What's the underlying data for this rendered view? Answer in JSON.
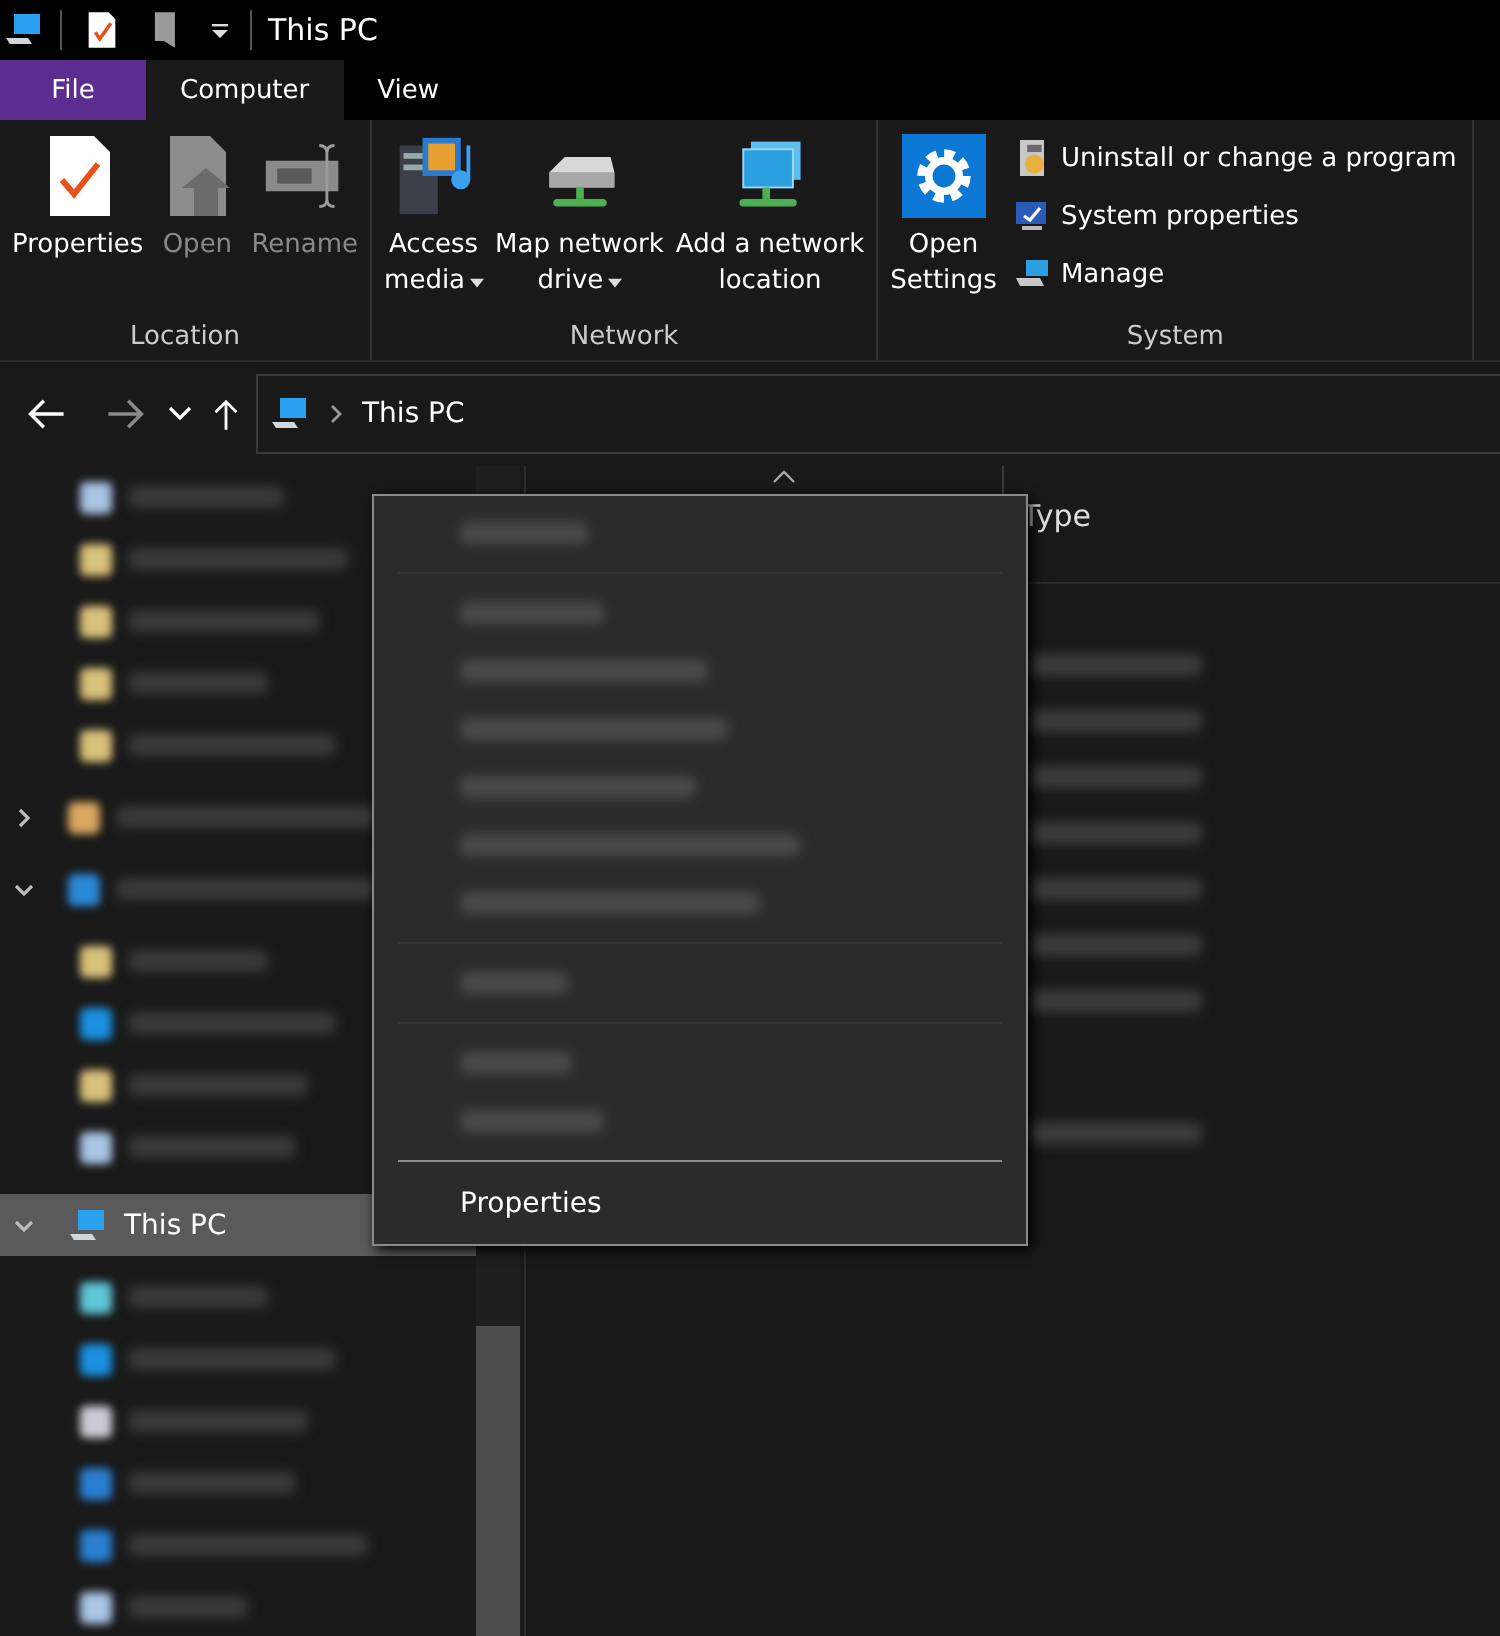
{
  "title_bar": {
    "title": "This PC"
  },
  "tabs": [
    {
      "label": "File",
      "kind": "file",
      "selected": false
    },
    {
      "label": "Computer",
      "kind": "tab",
      "selected": true
    },
    {
      "label": "View",
      "kind": "tab",
      "selected": false
    }
  ],
  "ribbon": {
    "groups": [
      {
        "label": "Location",
        "buttons": [
          {
            "lines": [
              "Properties"
            ],
            "disabled": false,
            "dropdown": false
          },
          {
            "lines": [
              "Open"
            ],
            "disabled": true,
            "dropdown": false
          },
          {
            "lines": [
              "Rename"
            ],
            "disabled": true,
            "dropdown": false
          }
        ]
      },
      {
        "label": "Network",
        "buttons": [
          {
            "lines": [
              "Access",
              "media"
            ],
            "disabled": false,
            "dropdown": true
          },
          {
            "lines": [
              "Map network",
              "drive"
            ],
            "disabled": false,
            "dropdown": true
          },
          {
            "lines": [
              "Add a network",
              "location"
            ],
            "disabled": false,
            "dropdown": false
          }
        ]
      },
      {
        "label": "System",
        "buttons": [
          {
            "lines": [
              "Open",
              "Settings"
            ],
            "disabled": false,
            "dropdown": false
          }
        ],
        "small": [
          {
            "label": "Uninstall or change a program"
          },
          {
            "label": "System properties"
          },
          {
            "label": "Manage"
          }
        ]
      }
    ]
  },
  "address": {
    "path": "This PC"
  },
  "tree": [
    {
      "kind": "offscreen",
      "children": [
        {
          "color": "#a9c4e4"
        },
        {
          "color": "#d9c27a"
        },
        {
          "color": "#d9c27a"
        },
        {
          "color": "#d9c27a"
        },
        {
          "color": "#d9c27a"
        }
      ]
    },
    {
      "kind": "blurred",
      "color": "#d9a860",
      "expanded": false
    },
    {
      "kind": "blurred",
      "color": "#2a8ad8",
      "expanded": true,
      "children": [
        {
          "color": "#d9c27a"
        },
        {
          "color": "#1a8fe0"
        },
        {
          "color": "#d9c27a"
        },
        {
          "color": "#a9c4e4"
        }
      ]
    },
    {
      "kind": "pc",
      "label": "This PC",
      "expanded": true,
      "selected": true,
      "children": [
        {
          "color": "#5fc6d8"
        },
        {
          "color": "#1a8fe0"
        },
        {
          "color": "#c8ccd4"
        },
        {
          "color": "#2a7ed0"
        },
        {
          "color": "#2a7ed0"
        },
        {
          "color": "#a9c4e4"
        }
      ]
    }
  ],
  "content": {
    "columns": [
      {
        "label": "Type"
      }
    ],
    "rows": [
      {
        "kind": "blurred"
      },
      {
        "kind": "blurred"
      },
      {
        "kind": "blurred"
      },
      {
        "kind": "blurred"
      },
      {
        "kind": "blurred"
      },
      {
        "kind": "blurred"
      },
      {
        "kind": "blurred"
      },
      {
        "kind": "gap"
      },
      {
        "kind": "blurred"
      }
    ]
  },
  "context_menu": {
    "items": [
      {
        "kind": "blurred"
      },
      {
        "kind": "separator"
      },
      {
        "kind": "blurred"
      },
      {
        "kind": "blurred"
      },
      {
        "kind": "blurred"
      },
      {
        "kind": "blurred"
      },
      {
        "kind": "blurred"
      },
      {
        "kind": "blurred"
      },
      {
        "kind": "separator"
      },
      {
        "kind": "blurred"
      },
      {
        "kind": "separator"
      },
      {
        "kind": "blurred"
      },
      {
        "kind": "blurred"
      },
      {
        "kind": "rule"
      },
      {
        "kind": "item",
        "label": "Properties"
      }
    ]
  }
}
